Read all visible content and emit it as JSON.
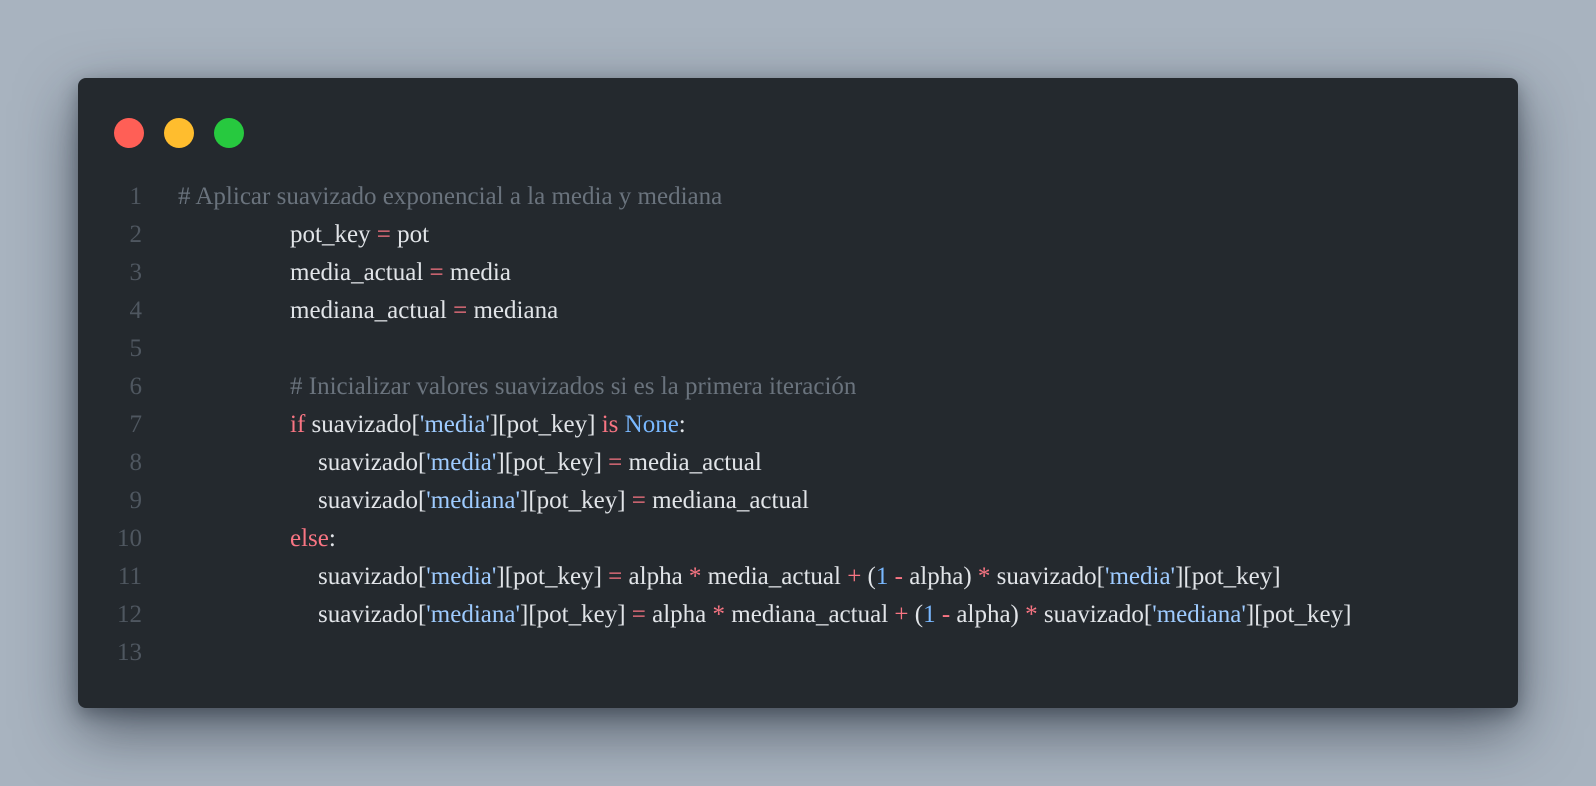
{
  "window": {
    "dots": [
      {
        "name": "close",
        "color": "#ff5f56"
      },
      {
        "name": "minimize",
        "color": "#ffbd2e"
      },
      {
        "name": "maximize",
        "color": "#27c93f"
      }
    ]
  },
  "code": {
    "line_numbers": [
      "1",
      "2",
      "3",
      "4",
      "5",
      "6",
      "7",
      "8",
      "9",
      "10",
      "11",
      "12",
      "13"
    ],
    "lines": [
      {
        "indent": 0,
        "tokens": [
          {
            "t": "comment",
            "v": "# Aplicar suavizado exponencial a la media y mediana"
          }
        ]
      },
      {
        "indent": 1,
        "tokens": [
          {
            "t": "var",
            "v": "pot_key "
          },
          {
            "t": "op",
            "v": "="
          },
          {
            "t": "var",
            "v": " pot"
          }
        ]
      },
      {
        "indent": 1,
        "tokens": [
          {
            "t": "var",
            "v": "media_actual "
          },
          {
            "t": "op",
            "v": "="
          },
          {
            "t": "var",
            "v": " media"
          }
        ]
      },
      {
        "indent": 1,
        "tokens": [
          {
            "t": "var",
            "v": "mediana_actual "
          },
          {
            "t": "op",
            "v": "="
          },
          {
            "t": "var",
            "v": " mediana"
          }
        ]
      },
      {
        "indent": 0,
        "tokens": []
      },
      {
        "indent": 1,
        "tokens": [
          {
            "t": "comment",
            "v": "# Inicializar valores suavizados si es la primera iteración"
          }
        ]
      },
      {
        "indent": 1,
        "tokens": [
          {
            "t": "kw",
            "v": "if"
          },
          {
            "t": "var",
            "v": " suavizado["
          },
          {
            "t": "str",
            "v": "'media'"
          },
          {
            "t": "var",
            "v": "][pot_key] "
          },
          {
            "t": "kw",
            "v": "is"
          },
          {
            "t": "const",
            "v": " None"
          },
          {
            "t": "punc",
            "v": ":"
          }
        ]
      },
      {
        "indent": 2,
        "tokens": [
          {
            "t": "var",
            "v": "suavizado["
          },
          {
            "t": "str",
            "v": "'media'"
          },
          {
            "t": "var",
            "v": "][pot_key] "
          },
          {
            "t": "op",
            "v": "="
          },
          {
            "t": "var",
            "v": " media_actual"
          }
        ]
      },
      {
        "indent": 2,
        "tokens": [
          {
            "t": "var",
            "v": "suavizado["
          },
          {
            "t": "str",
            "v": "'mediana'"
          },
          {
            "t": "var",
            "v": "][pot_key] "
          },
          {
            "t": "op",
            "v": "="
          },
          {
            "t": "var",
            "v": " mediana_actual"
          }
        ]
      },
      {
        "indent": 1,
        "tokens": [
          {
            "t": "kw",
            "v": "else"
          },
          {
            "t": "punc",
            "v": ":"
          }
        ]
      },
      {
        "indent": 2,
        "tokens": [
          {
            "t": "var",
            "v": "suavizado["
          },
          {
            "t": "str",
            "v": "'media'"
          },
          {
            "t": "var",
            "v": "][pot_key] "
          },
          {
            "t": "op",
            "v": "="
          },
          {
            "t": "var",
            "v": " alpha "
          },
          {
            "t": "op",
            "v": "*"
          },
          {
            "t": "var",
            "v": " media_actual "
          },
          {
            "t": "op",
            "v": "+"
          },
          {
            "t": "var",
            "v": " ("
          },
          {
            "t": "const",
            "v": "1"
          },
          {
            "t": "op",
            "v": " -"
          },
          {
            "t": "var",
            "v": " alpha) "
          },
          {
            "t": "op",
            "v": "*"
          },
          {
            "t": "var",
            "v": " suavizado["
          },
          {
            "t": "str",
            "v": "'media'"
          },
          {
            "t": "var",
            "v": "][pot_key]"
          }
        ]
      },
      {
        "indent": 2,
        "tokens": [
          {
            "t": "var",
            "v": "suavizado["
          },
          {
            "t": "str",
            "v": "'mediana'"
          },
          {
            "t": "var",
            "v": "][pot_key] "
          },
          {
            "t": "op",
            "v": "="
          },
          {
            "t": "var",
            "v": " alpha "
          },
          {
            "t": "op",
            "v": "*"
          },
          {
            "t": "var",
            "v": " mediana_actual "
          },
          {
            "t": "op",
            "v": "+"
          },
          {
            "t": "var",
            "v": " ("
          },
          {
            "t": "const",
            "v": "1"
          },
          {
            "t": "op",
            "v": " -"
          },
          {
            "t": "var",
            "v": " alpha) "
          },
          {
            "t": "op",
            "v": "*"
          },
          {
            "t": "var",
            "v": " suavizado["
          },
          {
            "t": "str",
            "v": "'mediana'"
          },
          {
            "t": "var",
            "v": "][pot_key]"
          }
        ]
      },
      {
        "indent": 0,
        "tokens": []
      }
    ]
  }
}
